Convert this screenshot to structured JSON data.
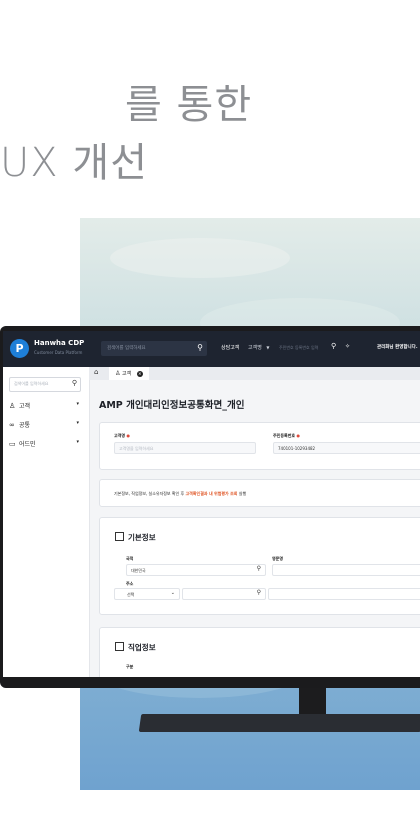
{
  "hero": {
    "line1": "를 통한",
    "line2": "UX 개선"
  },
  "header": {
    "logo_letter": "P",
    "brand": "Hanwha CDP",
    "brand_sub": "Customer Data Platform",
    "search_placeholder": "검색어를 입력하세요",
    "nav_consult": "상담고객",
    "nav_customer_select": "고객명",
    "nav_id_placeholder": "주민번호 등록번호 입력",
    "greeting": "관리화님 환영합니다."
  },
  "sidebar": {
    "search_placeholder": "검색어를 입력하세요",
    "items": [
      {
        "label": "고객"
      },
      {
        "label": "공통"
      },
      {
        "label": "어드민"
      }
    ]
  },
  "tabs": {
    "current": "고객"
  },
  "page": {
    "title": "AMP 개인대리인정보공통화면_개인"
  },
  "ident": {
    "name_label": "고객명",
    "name_placeholder": "고객명을 입력하세요",
    "rrn_label": "주민등록번호",
    "rrn_value": "740101-10293482"
  },
  "notice": {
    "prefix": "기본정보, 직업정보, 실소유자정보 확인 후 ",
    "highlight": "고객확인결과 내 위험평가 조회",
    "suffix": " 실행"
  },
  "basic": {
    "title": "기본정보",
    "country_label": "국적",
    "country_value": "대한민국",
    "eng_name_label": "영문명",
    "address_label": "주소",
    "address_select": "선택"
  },
  "job": {
    "title": "직업정보",
    "type_label": "구분"
  },
  "colors": {
    "accent": "#1e7fd8",
    "header_bg": "#1e2430",
    "highlight": "#e0592a",
    "required": "#e04b3c"
  }
}
